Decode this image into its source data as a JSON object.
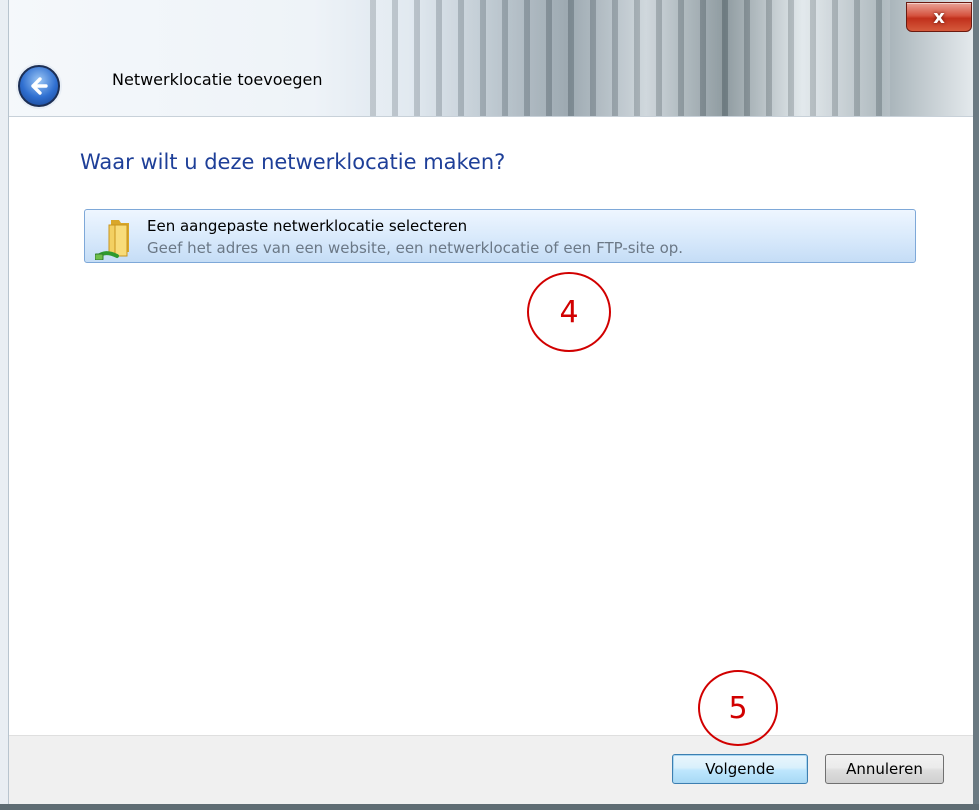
{
  "window": {
    "title": "Netwerklocatie toevoegen",
    "close_label": "x"
  },
  "main": {
    "heading": "Waar wilt u deze netwerklocatie maken?",
    "option": {
      "title": "Een aangepaste netwerklocatie selecteren",
      "description": "Geef het adres van een website, een netwerklocatie of een FTP-site op.",
      "icon": "network-folder-icon"
    }
  },
  "annotations": {
    "step_4": "4",
    "step_5": "5"
  },
  "buttons": {
    "next_label": "Volgende",
    "cancel_label": "Annuleren"
  },
  "colors": {
    "heading": "#1e3f98",
    "annotation": "#d10000",
    "option_border": "#7ea8d8"
  }
}
